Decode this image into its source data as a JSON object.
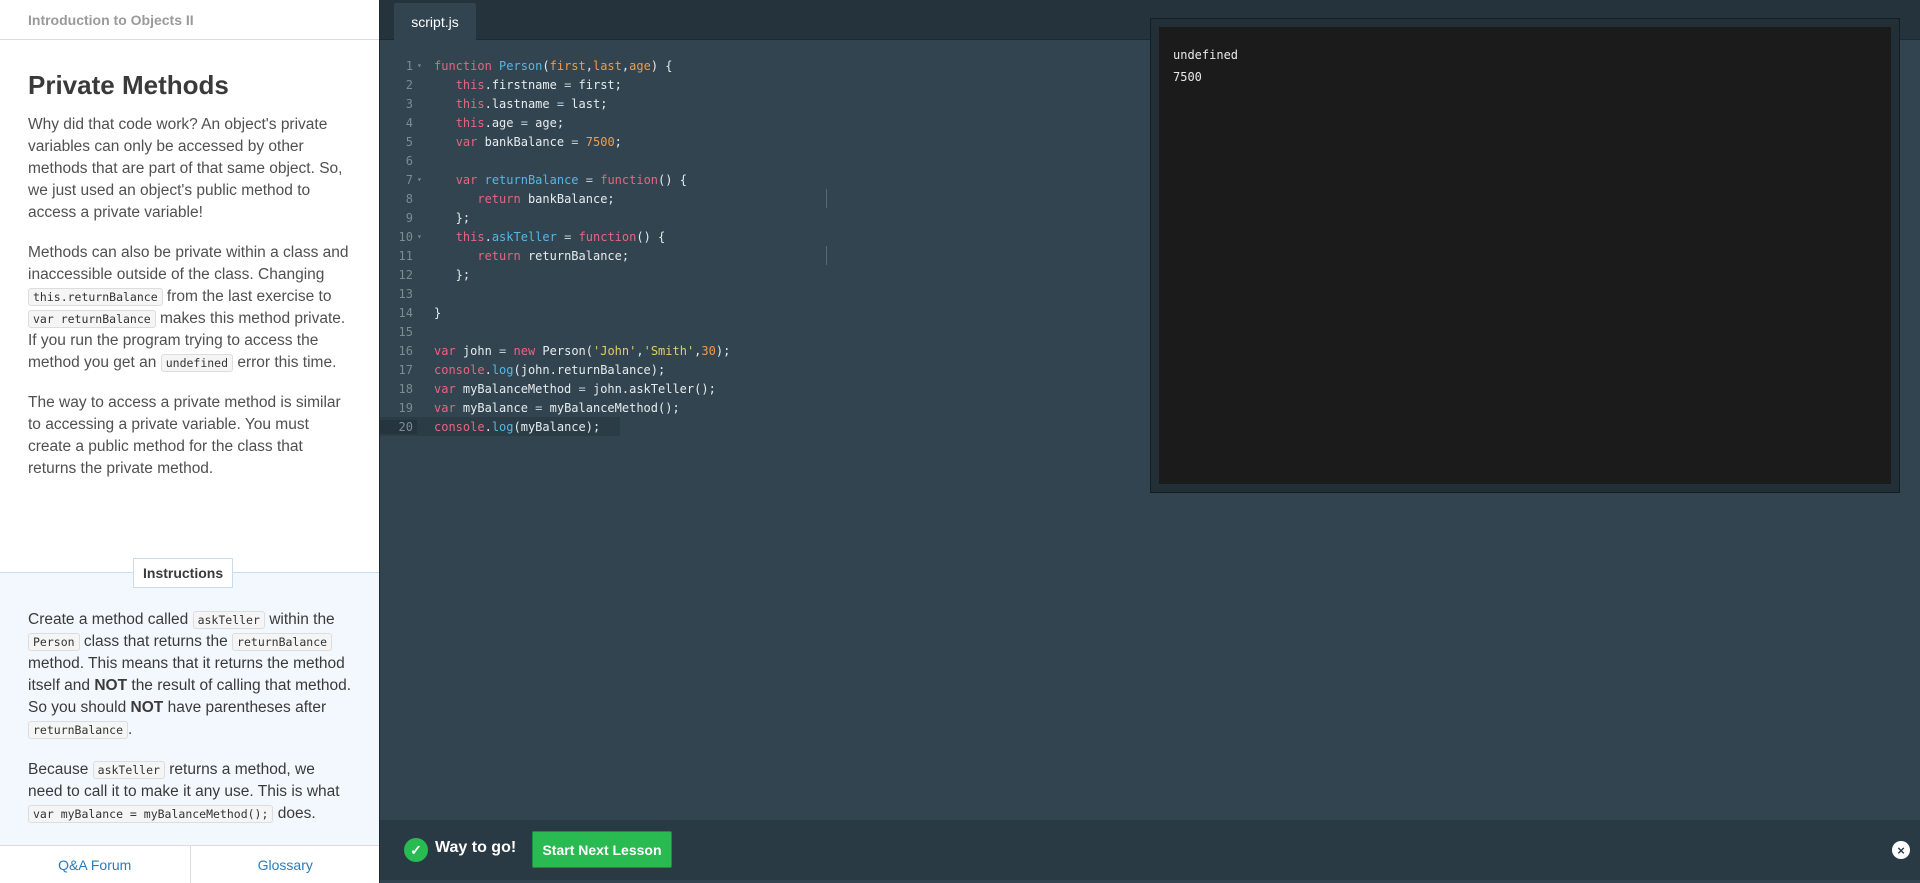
{
  "course": {
    "title": "Introduction to Objects II"
  },
  "lesson": {
    "title": "Private Methods",
    "p1": "Why did that code work? An object's private variables can only be accessed by other methods that are part of that same object. So, we just used an object's public method to access a private variable!",
    "p2": {
      "a": "Methods can also be private within a class and inaccessible outside of the class. Changing ",
      "code1": "this.returnBalance",
      "b": " from the last exercise to ",
      "code2": "var returnBalance",
      "c": " makes this method private. If you run the program trying to access the method you get an ",
      "code3": "undefined",
      "d": " error this time."
    },
    "p3": "The way to access a private method is similar to accessing a private variable. You must create a public method for the class that returns the private method."
  },
  "instructions": {
    "label": "Instructions",
    "p1": {
      "a": "Create a method called ",
      "code1": "askTeller",
      "b": " within the ",
      "code2": "Person",
      "c": " class that returns the ",
      "code3": "returnBalance",
      "d": " method. This means that it returns the method itself and ",
      "bold1": "NOT",
      "e": " the result of calling that method. So you should ",
      "bold2": "NOT",
      "f": " have parentheses after ",
      "code4": "returnBalance",
      "g": "."
    },
    "p2": {
      "a": "Because ",
      "code1": "askTeller",
      "b": " returns a method, we need to call it to make it any use. This is what ",
      "code2": "var myBalance = myBalanceMethod();",
      "c": " does."
    }
  },
  "footer": {
    "qa": "Q&A Forum",
    "glossary": "Glossary"
  },
  "editor": {
    "tab": "script.js",
    "lines": [
      "function Person(first,last,age) {",
      "   this.firstname = first;",
      "   this.lastname = last;",
      "   this.age = age;",
      "   var bankBalance = 7500;",
      "",
      "   var returnBalance = function() {",
      "      return bankBalance;",
      "   };",
      "   this.askTeller = function() {",
      "      return returnBalance;",
      "   };",
      "",
      "}",
      "",
      "var john = new Person('John','Smith',30);",
      "console.log(john.returnBalance);",
      "var myBalanceMethod = john.askTeller();",
      "var myBalance = myBalanceMethod();",
      "console.log(myBalance);"
    ]
  },
  "console": {
    "output": [
      "undefined",
      "7500"
    ]
  },
  "success": {
    "message": "Way to go!",
    "button": "Start Next Lesson"
  },
  "icons": {
    "check": "check-icon",
    "close": "close-icon",
    "fold": "fold-arrow-icon"
  },
  "colors": {
    "success_green": "#2aba52",
    "editor_bg": "#32444f",
    "console_bg": "#1b1b1b",
    "link_blue": "#2b7bb9"
  }
}
